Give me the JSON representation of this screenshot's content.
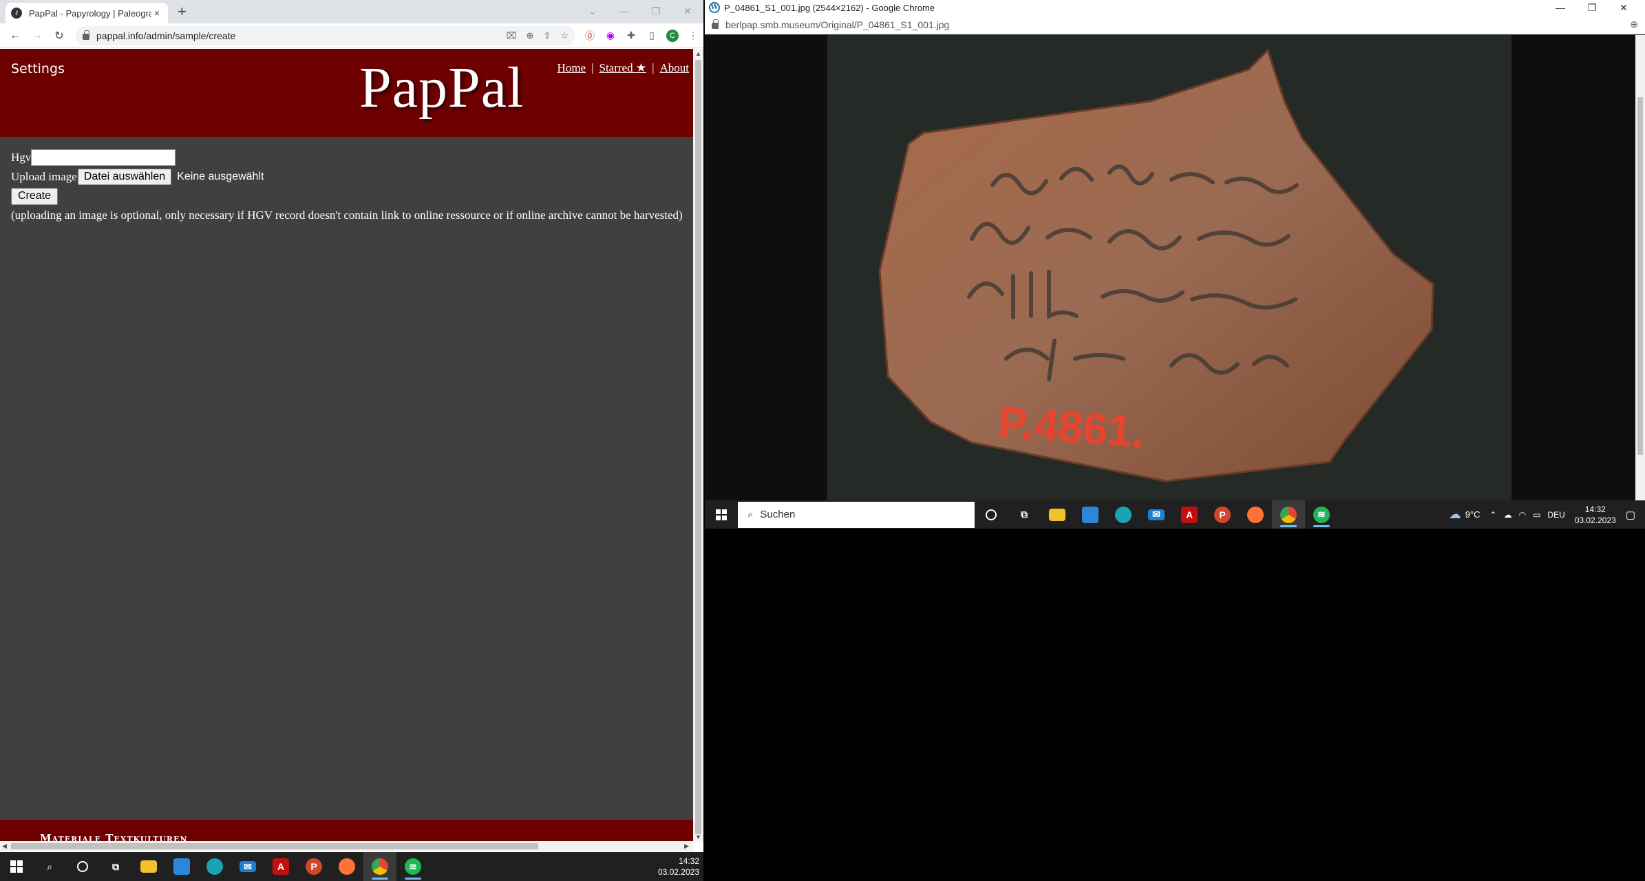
{
  "left_browser": {
    "tab": {
      "title": "PapPal - Papyrology | Paleograph",
      "close": "×"
    },
    "new_tab": "+",
    "window_controls": {
      "minimize": "—",
      "restore": "❐",
      "close": "✕",
      "dropdown": "⌄"
    },
    "url": "pappal.info/admin/sample/create",
    "profile_initial": "C"
  },
  "page": {
    "settings": "Settings",
    "logo": "PapPal",
    "nav": [
      {
        "label": "Home"
      },
      {
        "label": "Starred ★"
      },
      {
        "label": "About"
      }
    ],
    "nav_separator": "|",
    "form": {
      "hgv_label": "Hgv",
      "hgv_value": "",
      "upload_label": "Upload image",
      "file_button": "Datei auswählen",
      "file_status": "Keine ausgewählt",
      "create_button": "Create",
      "hint": "(uploading an image is optional, only necessary if HGV record doesn't contain link to online ressource or if online archive cannot be harvested)"
    },
    "footer_text": "Materiale Textkulturen"
  },
  "left_taskbar": {
    "clock": {
      "time": "14:32",
      "date": "03.02.2023"
    }
  },
  "right_browser": {
    "title": "P_04861_S1_001.jpg (2544×2162) - Google Chrome",
    "url": "berlpap.smb.museum/Original/P_04861_S1_001.jpg",
    "window_controls": {
      "minimize": "—",
      "restore": "❐",
      "close": "✕"
    },
    "image_label": "P.4861.",
    "image_alt": "Ostracon P 4861"
  },
  "right_taskbar": {
    "search_placeholder": "Suchen",
    "weather": "9°C",
    "language": "DEU",
    "clock": {
      "time": "14:32",
      "date": "03.02.2023"
    }
  },
  "colors": {
    "header_bg": "#6e0000",
    "page_bg": "#404040",
    "taskbar_bg": "#202020",
    "annotation_red": "#e8442e"
  }
}
